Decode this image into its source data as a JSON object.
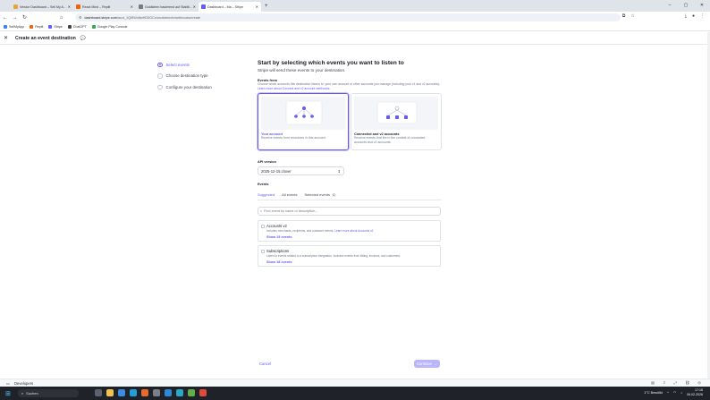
{
  "browser": {
    "tabs": [
      {
        "label": "Vendor Dashboard – Sell My A…",
        "color": "#e7a43f",
        "active": false
      },
      {
        "label": "React Mind – Replit",
        "color": "#f26207",
        "active": false
      },
      {
        "label": "Goldideen basierend auf Stabili…",
        "color": "#7b7b7b",
        "active": false
      },
      {
        "label": "Dashboard – Ma – Stripe",
        "color": "#635bff",
        "active": true
      }
    ],
    "new_tab": "+",
    "url_host": "dashboard.stripe.com",
    "url_path": "/acct_1Qt5Wv8wHD5GCx/workbench/webhooks/create",
    "bookmarks": [
      {
        "label": "SellMyApp",
        "color": "#3b82f6"
      },
      {
        "label": "Replit",
        "color": "#f26207"
      },
      {
        "label": "Stripe",
        "color": "#635bff"
      },
      {
        "label": "ChatGPT",
        "color": "#444444"
      },
      {
        "label": "Google Play Console",
        "color": "#34a853"
      }
    ]
  },
  "header": {
    "title": "Create an event destination"
  },
  "steps": [
    {
      "label": "Select events",
      "active": true
    },
    {
      "label": "Choose destination type",
      "active": false
    },
    {
      "label": "Configure your destination",
      "active": false
    }
  ],
  "main": {
    "heading": "Start by selecting which events you want to listen to",
    "subheading": "Stripe will send these events to your destination.",
    "events_from_label": "Events from",
    "events_from_help": "Choose which accounts this destination listens to: your own account or other accounts you manage (including your v1 and v2 accounts).",
    "events_from_link": "Learn more about Connect and v2 account webhooks.",
    "cards": [
      {
        "title": "Your account",
        "desc": "Receive events from resources in this account.",
        "selected": true
      },
      {
        "title": "Connected and v2 accounts",
        "desc": "Receive events that fire in the context of connected accounts and v2 accounts.",
        "selected": false
      }
    ],
    "api_version_label": "API version",
    "api_version_value": "2025-12-15.clover",
    "events_label": "Events",
    "tabs": [
      {
        "label": "Suggested",
        "active": true,
        "badge": ""
      },
      {
        "label": "All events",
        "active": false,
        "badge": ""
      },
      {
        "label": "Selected events",
        "active": false,
        "badge": "0"
      }
    ],
    "search_placeholder": "Find event by name or description...",
    "groups": [
      {
        "title": "Accounts v2",
        "desc": "Includes merchants, recipients, and customer events.",
        "link": "Learn more about Accounts v2",
        "show": "Show 15 events"
      },
      {
        "title": "Subscriptions",
        "desc": "Listen to events related to a subscription integration. Includes events from billing, invoices, and customers.",
        "link": "",
        "show": "Show 18 events"
      }
    ],
    "cancel": "Cancel",
    "continue": "Continue"
  },
  "devbar": {
    "label": "Developers"
  },
  "taskbar": {
    "search": "Suchen",
    "weather": "1°C Bewölkt",
    "time": "17:18",
    "date": "06.02.2026"
  }
}
